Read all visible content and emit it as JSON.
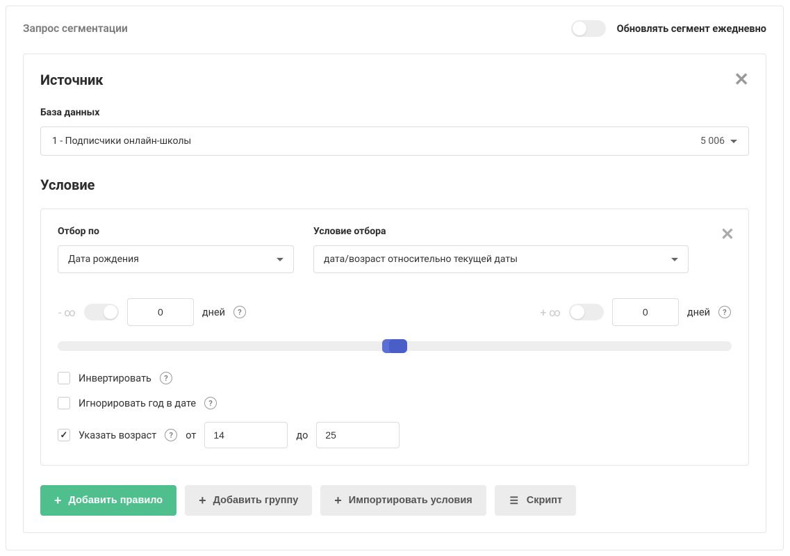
{
  "header": {
    "title": "Запрос сегментации",
    "update_toggle_label": "Обновлять сегмент ежедневно"
  },
  "source": {
    "title": "Источник",
    "db_label": "База данных",
    "db_value": "1 - Подписчики онлайн-школы",
    "db_count": "5 006"
  },
  "condition": {
    "title": "Условие",
    "filter_by_label": "Отбор по",
    "filter_by_value": "Дата рождения",
    "criteria_label": "Условие отбора",
    "criteria_value": "дата/возраст относительно текущей даты",
    "range": {
      "left_inf": "- ∞",
      "left_value": "0",
      "left_unit": "дней",
      "right_inf": "+ ∞",
      "right_value": "0",
      "right_unit": "дней"
    },
    "invert_label": "Инвертировать",
    "ignore_year_label": "Игнорировать год в дате",
    "age_checkbox_label": "Указать возраст",
    "age_from_label": "от",
    "age_from_value": "14",
    "age_to_label": "до",
    "age_to_value": "25"
  },
  "buttons": {
    "add_rule": "Добавить правило",
    "add_group": "Добавить группу",
    "import": "Импортировать условия",
    "script": "Скрипт"
  }
}
